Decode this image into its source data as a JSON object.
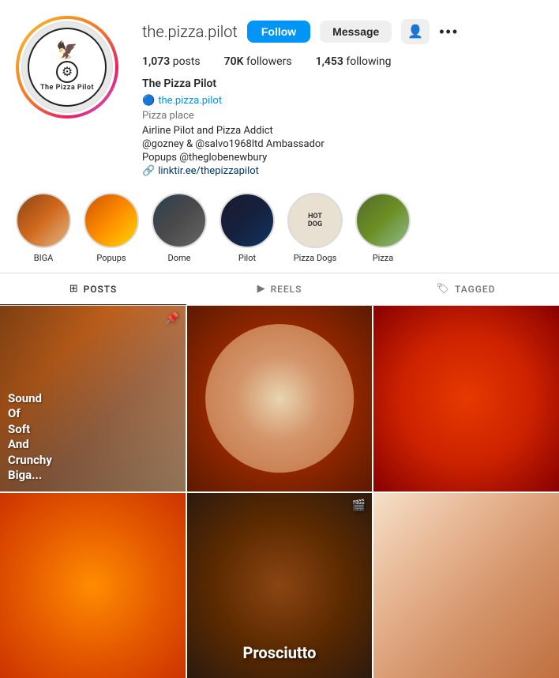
{
  "profile": {
    "username": "the.pizza.pilot",
    "display_name": "The Pizza Pilot",
    "verified_handle": "the.pizza.pilot",
    "category": "Pizza place",
    "bio_line1": "Airline Pilot and Pizza Addict",
    "bio_line2": "@gozney & @salvo1968ltd Ambassador",
    "bio_line3": "Popups @theglobenewbury",
    "bio_link": "linktir.ee/thepizzapilot",
    "posts_count": "1,073",
    "posts_label": "posts",
    "followers_count": "70K",
    "followers_label": "followers",
    "following_count": "1,453",
    "following_label": "following",
    "follow_btn": "Follow",
    "message_btn": "Message"
  },
  "stories": [
    {
      "id": "biga",
      "label": "BIGA"
    },
    {
      "id": "popups",
      "label": "Popups"
    },
    {
      "id": "dome",
      "label": "Dome"
    },
    {
      "id": "pilot",
      "label": "Pilot"
    },
    {
      "id": "pizzadogs",
      "label": "Pizza Dogs"
    },
    {
      "id": "pizza",
      "label": "Pizza"
    }
  ],
  "tabs": [
    {
      "id": "posts",
      "label": "POSTS",
      "icon": "⊞",
      "active": true
    },
    {
      "id": "reels",
      "label": "REELS",
      "icon": "▶",
      "active": false
    },
    {
      "id": "tagged",
      "label": "TAGGED",
      "icon": "🏷",
      "active": false
    }
  ],
  "posts": [
    {
      "id": "p1",
      "text": "Sound\nOf\nSoft\nAnd\nCrunchy\nBiga..."
    },
    {
      "id": "p2",
      "text": ""
    },
    {
      "id": "p3",
      "text": ""
    },
    {
      "id": "p4",
      "text": ""
    },
    {
      "id": "p5",
      "text": "Prosciutto"
    },
    {
      "id": "p6",
      "text": ""
    }
  ]
}
